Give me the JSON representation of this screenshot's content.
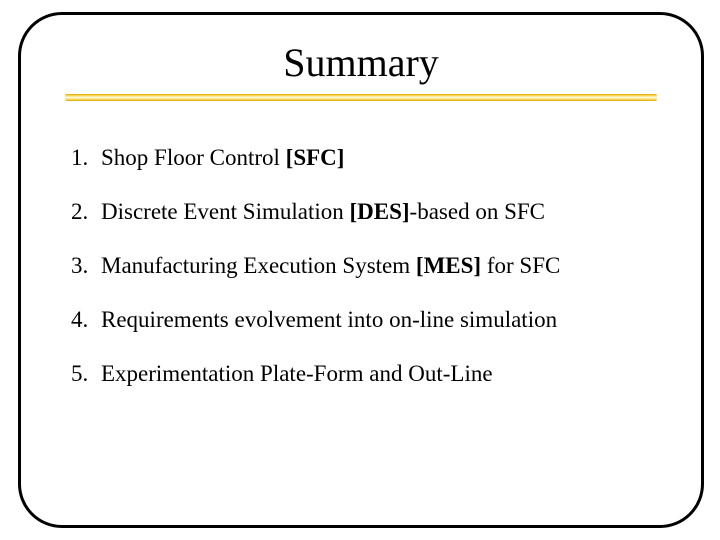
{
  "title": "Summary",
  "items": [
    {
      "pre": "Shop Floor Control ",
      "bold": "[SFC]",
      "post": ""
    },
    {
      "pre": "Discrete Event Simulation ",
      "bold": "[DES]",
      "post": "-based on SFC"
    },
    {
      "pre": "Manufacturing Execution System ",
      "bold": "[MES]",
      "post": " for SFC"
    },
    {
      "pre": "Requirements evolvement into on-line simulation",
      "bold": "",
      "post": ""
    },
    {
      "pre": "Experimentation Plate-Form and Out-Line",
      "bold": "",
      "post": ""
    }
  ]
}
